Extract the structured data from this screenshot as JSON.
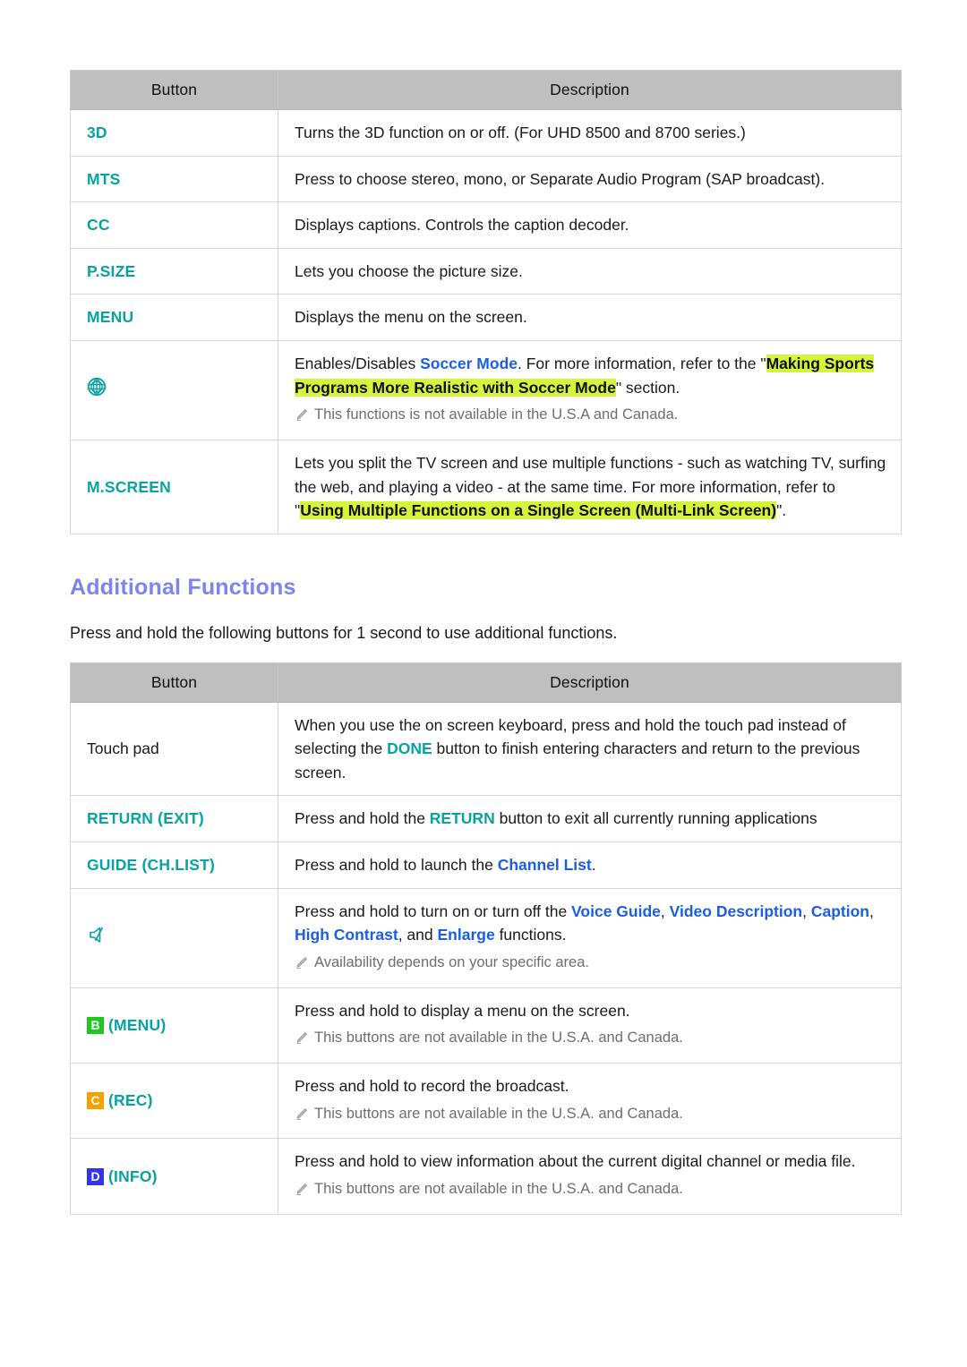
{
  "colors": {
    "teal": "#07a3a3",
    "blue_link": "#1b5fe0",
    "heading_blue": "#7b85f0",
    "highlight_yellow": "#d6f43c",
    "header_gray": "#bfbfbf",
    "badge_b_green": "#22c522",
    "badge_c_orange": "#f5a200",
    "badge_d_blue": "#3333ee"
  },
  "table1": {
    "headers": {
      "button": "Button",
      "description": "Description"
    },
    "rows": [
      {
        "button_label": "3D",
        "desc_parts": [
          {
            "t": "Turns the 3D function on or off. (For UHD 8500 and 8700 series.)",
            "s": "plain"
          }
        ]
      },
      {
        "button_label": "MTS",
        "desc_parts": [
          {
            "t": "Press to choose stereo, mono, or Separate Audio Program (SAP broadcast).",
            "s": "plain"
          }
        ]
      },
      {
        "button_label": "CC",
        "desc_parts": [
          {
            "t": "Displays captions. Controls the caption decoder.",
            "s": "plain"
          }
        ]
      },
      {
        "button_label": "P.SIZE",
        "desc_parts": [
          {
            "t": "Lets you choose the picture size.",
            "s": "plain"
          }
        ]
      },
      {
        "button_label": "MENU",
        "desc_parts": [
          {
            "t": "Displays the menu on the screen.",
            "s": "plain"
          }
        ]
      },
      {
        "button_icon": "soccer-ball-icon",
        "desc_parts": [
          {
            "t": "Enables/Disables ",
            "s": "plain"
          },
          {
            "t": "Soccer Mode",
            "s": "blue"
          },
          {
            "t": ". For more information, refer to the \"",
            "s": "plain"
          },
          {
            "t": "Making Sports Programs More Realistic with Soccer Mode",
            "s": "highlight"
          },
          {
            "t": "\" section.",
            "s": "plain"
          }
        ],
        "note": "This functions is not available in the U.S.A and Canada."
      },
      {
        "button_label": "M.SCREEN",
        "desc_parts": [
          {
            "t": "Lets you split the TV screen and use multiple functions - such as watching TV, surfing the web, and playing a video - at the same time. For more information, refer to \"",
            "s": "plain"
          },
          {
            "t": "Using Multiple Functions on a Single Screen (Multi-Link Screen)",
            "s": "highlight"
          },
          {
            "t": "\".",
            "s": "plain"
          }
        ]
      }
    ]
  },
  "section": {
    "title": "Additional Functions",
    "lead": "Press and hold the following buttons for 1 second to use additional functions."
  },
  "table2": {
    "headers": {
      "button": "Button",
      "description": "Description"
    },
    "rows": [
      {
        "button_label": "Touch pad",
        "button_style": "plain",
        "desc_parts": [
          {
            "t": "When you use the on screen keyboard, press and hold the touch pad instead of selecting the ",
            "s": "plain"
          },
          {
            "t": "DONE",
            "s": "teal"
          },
          {
            "t": " button to finish entering characters and return to the previous screen.",
            "s": "plain"
          }
        ]
      },
      {
        "button_label": "RETURN (EXIT)",
        "button_style": "teal",
        "desc_parts": [
          {
            "t": "Press and hold the ",
            "s": "plain"
          },
          {
            "t": "RETURN",
            "s": "teal"
          },
          {
            "t": " button to exit all currently running applications",
            "s": "plain"
          }
        ]
      },
      {
        "button_label": "GUIDE (CH.LIST)",
        "button_style": "teal",
        "desc_parts": [
          {
            "t": "Press and hold to launch the ",
            "s": "plain"
          },
          {
            "t": "Channel List",
            "s": "blue"
          },
          {
            "t": ".",
            "s": "plain"
          }
        ]
      },
      {
        "button_icon": "mute-speaker-icon",
        "desc_parts": [
          {
            "t": "Press and hold to turn on or turn off the ",
            "s": "plain"
          },
          {
            "t": "Voice Guide",
            "s": "blue"
          },
          {
            "t": ", ",
            "s": "plain"
          },
          {
            "t": "Video Description",
            "s": "blue"
          },
          {
            "t": ", ",
            "s": "plain"
          },
          {
            "t": "Caption",
            "s": "blue"
          },
          {
            "t": ", ",
            "s": "plain"
          },
          {
            "t": "High Contrast",
            "s": "blue"
          },
          {
            "t": ", and ",
            "s": "plain"
          },
          {
            "t": "Enlarge",
            "s": "blue"
          },
          {
            "t": " functions.",
            "s": "plain"
          }
        ],
        "note": "Availability depends on your specific area."
      },
      {
        "badge_letter": "B",
        "badge_color_key": "badge_b_green",
        "button_label": "(MENU)",
        "button_style": "teal",
        "desc_parts": [
          {
            "t": "Press and hold to display a menu on the screen.",
            "s": "plain"
          }
        ],
        "note": "This buttons are not available in the U.S.A. and Canada."
      },
      {
        "badge_letter": "C",
        "badge_color_key": "badge_c_orange",
        "button_label": "(REC)",
        "button_style": "teal",
        "desc_parts": [
          {
            "t": "Press and hold to record the broadcast.",
            "s": "plain"
          }
        ],
        "note": "This buttons are not available in the U.S.A. and Canada."
      },
      {
        "badge_letter": "D",
        "badge_color_key": "badge_d_blue",
        "button_label": "(INFO)",
        "button_style": "teal",
        "desc_parts": [
          {
            "t": "Press and hold to view information about the current digital channel or media file.",
            "s": "plain"
          }
        ],
        "note": "This buttons are not available in the U.S.A. and Canada."
      }
    ]
  }
}
